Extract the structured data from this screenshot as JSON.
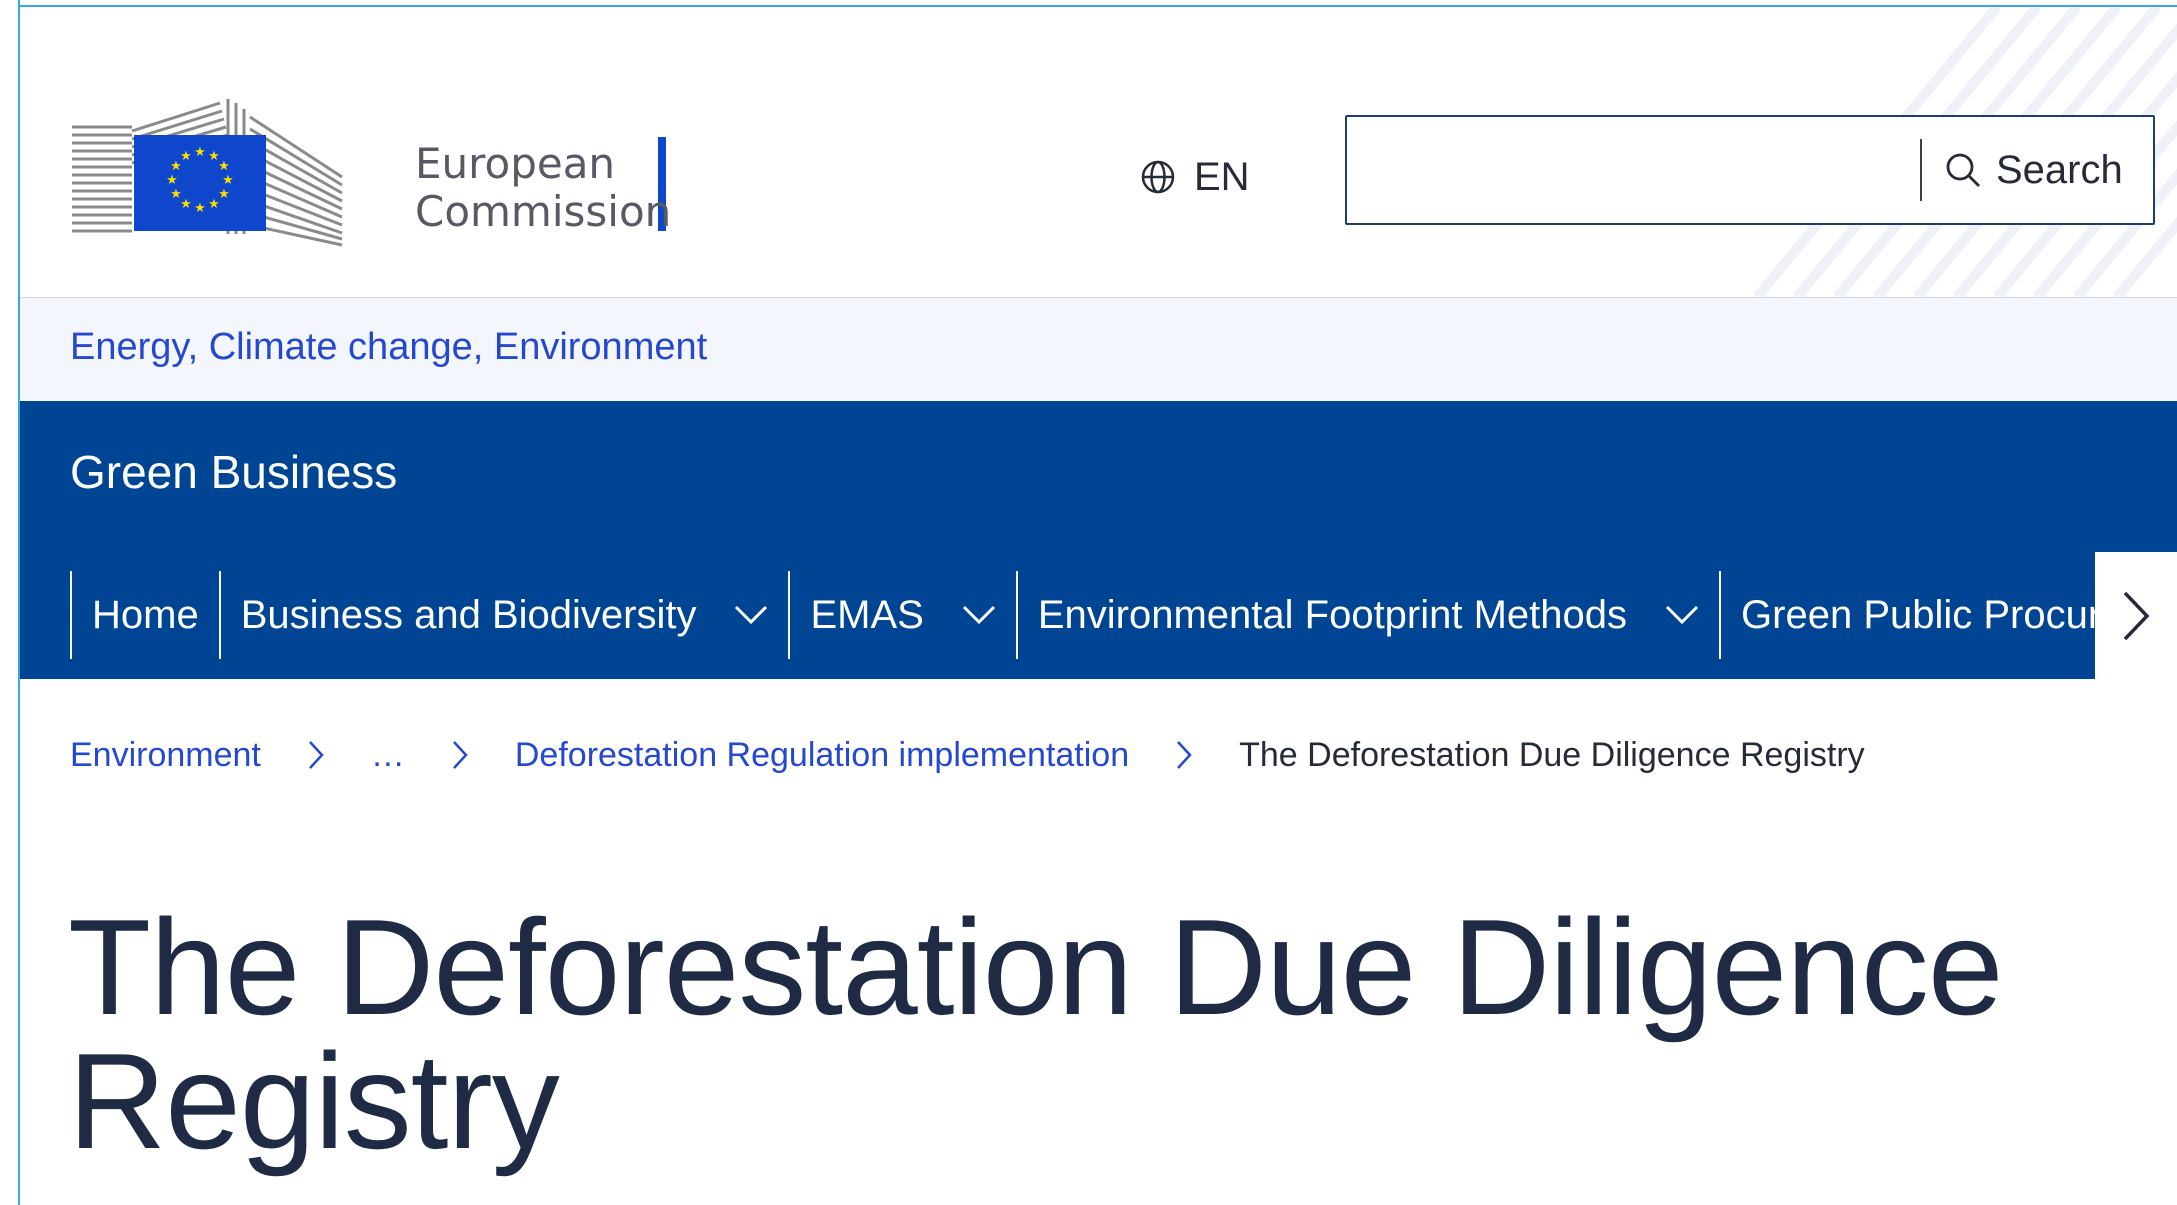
{
  "header": {
    "logo": {
      "line1": "European",
      "line2": "Commission",
      "flag_color": "#0e47cb",
      "star_color": "#ffdd00"
    },
    "language": {
      "icon": "globe-icon",
      "label": "EN"
    },
    "search": {
      "value": "",
      "placeholder": "",
      "button_label": "Search",
      "icon": "search-icon"
    }
  },
  "site_bar": {
    "link_text": "Energy, Climate change, Environment"
  },
  "nav": {
    "site_name": "Green Business",
    "background_color": "#004494",
    "items": [
      {
        "label": "Home",
        "has_dropdown": false
      },
      {
        "label": "Business and Biodiversity",
        "has_dropdown": true
      },
      {
        "label": "EMAS",
        "has_dropdown": true
      },
      {
        "label": "Environmental Footprint Methods",
        "has_dropdown": true
      },
      {
        "label": "Green Public Procurement",
        "has_dropdown": false
      }
    ],
    "next_icon": "chevron-right-icon"
  },
  "breadcrumb": {
    "items": [
      {
        "label": "Environment"
      },
      {
        "label": "…"
      },
      {
        "label": "Deforestation Regulation implementation"
      }
    ],
    "current": "The Deforestation Due Diligence Registry",
    "separator_icon": "chevron-right-icon"
  },
  "page": {
    "title": "The Deforestation Due Diligence Registry"
  },
  "colors": {
    "link": "#2548d1",
    "text": "#262b38",
    "title": "#1f2a44",
    "accent_bar": "#0e47cb"
  }
}
